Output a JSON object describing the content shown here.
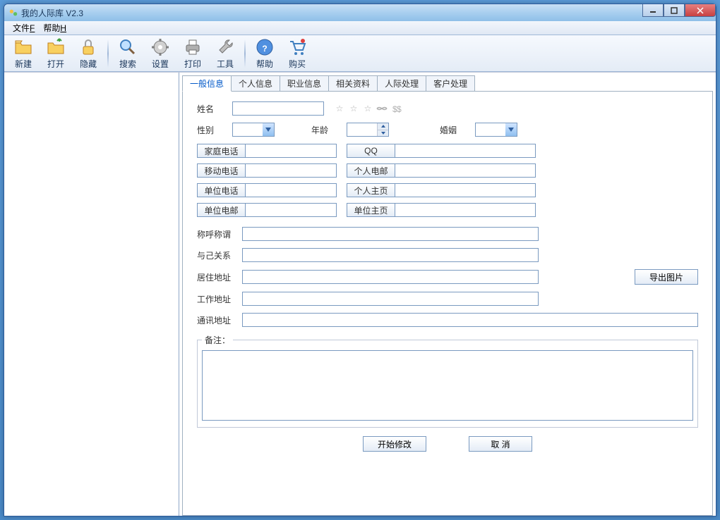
{
  "window": {
    "title": "我的人际库 V2.3"
  },
  "menubar": {
    "file": "文件",
    "file_u": "F",
    "help": "帮助",
    "help_u": "H"
  },
  "toolbar": {
    "new": "新建",
    "open": "打开",
    "hide": "隐藏",
    "search": "搜索",
    "settings": "设置",
    "print": "打印",
    "tools": "工具",
    "help": "帮助",
    "buy": "购买"
  },
  "tabs": [
    "一般信息",
    "个人信息",
    "职业信息",
    "相关资料",
    "人际处理",
    "客户处理"
  ],
  "form": {
    "name": "姓名",
    "gender": "性别",
    "age": "年龄",
    "marriage": "婚姻",
    "home_phone": "家庭电话",
    "mobile_phone": "移动电话",
    "work_phone": "单位电话",
    "work_email": "单位电邮",
    "qq": "QQ",
    "personal_email": "个人电邮",
    "personal_page": "个人主页",
    "work_page": "单位主页",
    "salutation": "称呼称谓",
    "relation": "与己关系",
    "home_addr": "居住地址",
    "work_addr": "工作地址",
    "mail_addr": "通讯地址",
    "remarks": "备注：",
    "export_img": "导出图片",
    "start_edit": "开始修改",
    "cancel": "取  消"
  },
  "values": {
    "name": "",
    "gender": "",
    "age": "",
    "marriage": "",
    "home_phone": "",
    "mobile_phone": "",
    "work_phone": "",
    "work_email": "",
    "qq": "",
    "personal_email": "",
    "personal_page": "",
    "work_page": "",
    "salutation": "",
    "relation": "",
    "home_addr": "",
    "work_addr": "",
    "mail_addr": "",
    "remarks": ""
  }
}
